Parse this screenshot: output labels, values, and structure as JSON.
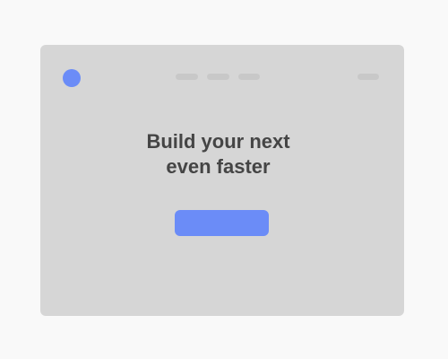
{
  "hero": {
    "headline_line1": "Build your next",
    "headline_line2": "even faster"
  },
  "header": {
    "logo_icon": "circle-logo-icon",
    "nav_items": [
      "",
      "",
      "",
      ""
    ]
  },
  "cta": {
    "label": ""
  },
  "colors": {
    "accent": "#6b8cf7",
    "window_bg": "#d6d6d6",
    "page_bg": "#f9f9f9",
    "nav_placeholder": "#c8c8c8",
    "headline_text": "#454545"
  }
}
